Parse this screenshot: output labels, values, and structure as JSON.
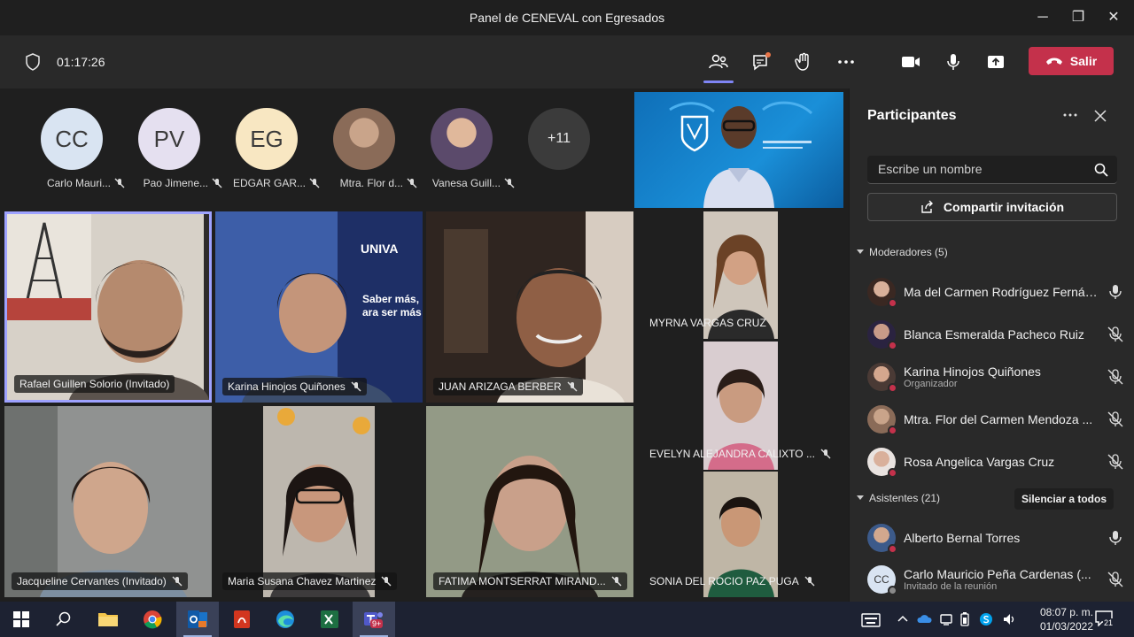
{
  "window": {
    "title": "Panel de CENEVAL con Egresados",
    "minimize": "─",
    "maximize": "❐",
    "close": "✕"
  },
  "toolbar": {
    "timer": "01:17:26",
    "leave_label": "Salir"
  },
  "stage": {
    "avatars": [
      {
        "initials": "CC",
        "name": "Carlo Mauri...",
        "color": "#d9e4f2"
      },
      {
        "initials": "PV",
        "name": "Pao Jimene...",
        "color": "#e5e0f0"
      },
      {
        "initials": "EG",
        "name": "EDGAR GAR...",
        "color": "#f8e7c2"
      },
      {
        "initials": "",
        "name": "Mtra. Flor d...",
        "color": "#8a6b58"
      },
      {
        "initials": "",
        "name": "Vanesa Guill...",
        "color": "#5b4a6b"
      }
    ],
    "more": "+11",
    "tiles": [
      {
        "name": "Rafael Guillen Solorio (Invitado)"
      },
      {
        "name": "Karina Hinojos Quiñones"
      },
      {
        "name": "JUAN ARIZAGA BERBER"
      },
      {
        "name": "MYRNA VARGAS CRUZ"
      },
      {
        "name": "EVELYN ALEJANDRA CALIXTO ..."
      },
      {
        "name": "Jacqueline Cervantes (Invitado)"
      },
      {
        "name": "Maria Susana Chavez Martinez"
      },
      {
        "name": "FATIMA MONTSERRAT MIRAND..."
      },
      {
        "name": "SONIA DEL ROCIO PAZ PUGA"
      }
    ],
    "univa": {
      "brand": "UNIVA",
      "line1": "Saber más,",
      "line2": "ara ser más"
    }
  },
  "panel": {
    "title": "Participantes",
    "search_placeholder": "Escribe un nombre",
    "share_label": "Compartir invitación",
    "moderators_label": "Moderadores (5)",
    "attendees_label": "Asistentes (21)",
    "mute_all": "Silenciar a todos",
    "moderators": [
      {
        "name": "Ma del Carmen Rodríguez Fernánd...",
        "role": "",
        "muted": false
      },
      {
        "name": "Blanca Esmeralda Pacheco Ruiz",
        "role": "",
        "muted": true
      },
      {
        "name": "Karina Hinojos Quiñones",
        "role": "Organizador",
        "muted": true
      },
      {
        "name": "Mtra. Flor del Carmen Mendoza ...",
        "role": "",
        "muted": true
      },
      {
        "name": "Rosa Angelica Vargas Cruz",
        "role": "",
        "muted": true
      }
    ],
    "attendees": [
      {
        "name": "Alberto Bernal Torres",
        "role": "",
        "muted": false,
        "initials": ""
      },
      {
        "name": "Carlo Mauricio Peña Cardenas (...",
        "role": "Invitado de la reunión",
        "muted": true,
        "initials": "CC"
      }
    ]
  },
  "taskbar": {
    "time": "08:07 p. m.",
    "date": "01/03/2022",
    "notifications": "21",
    "teams_badge": "9+"
  }
}
